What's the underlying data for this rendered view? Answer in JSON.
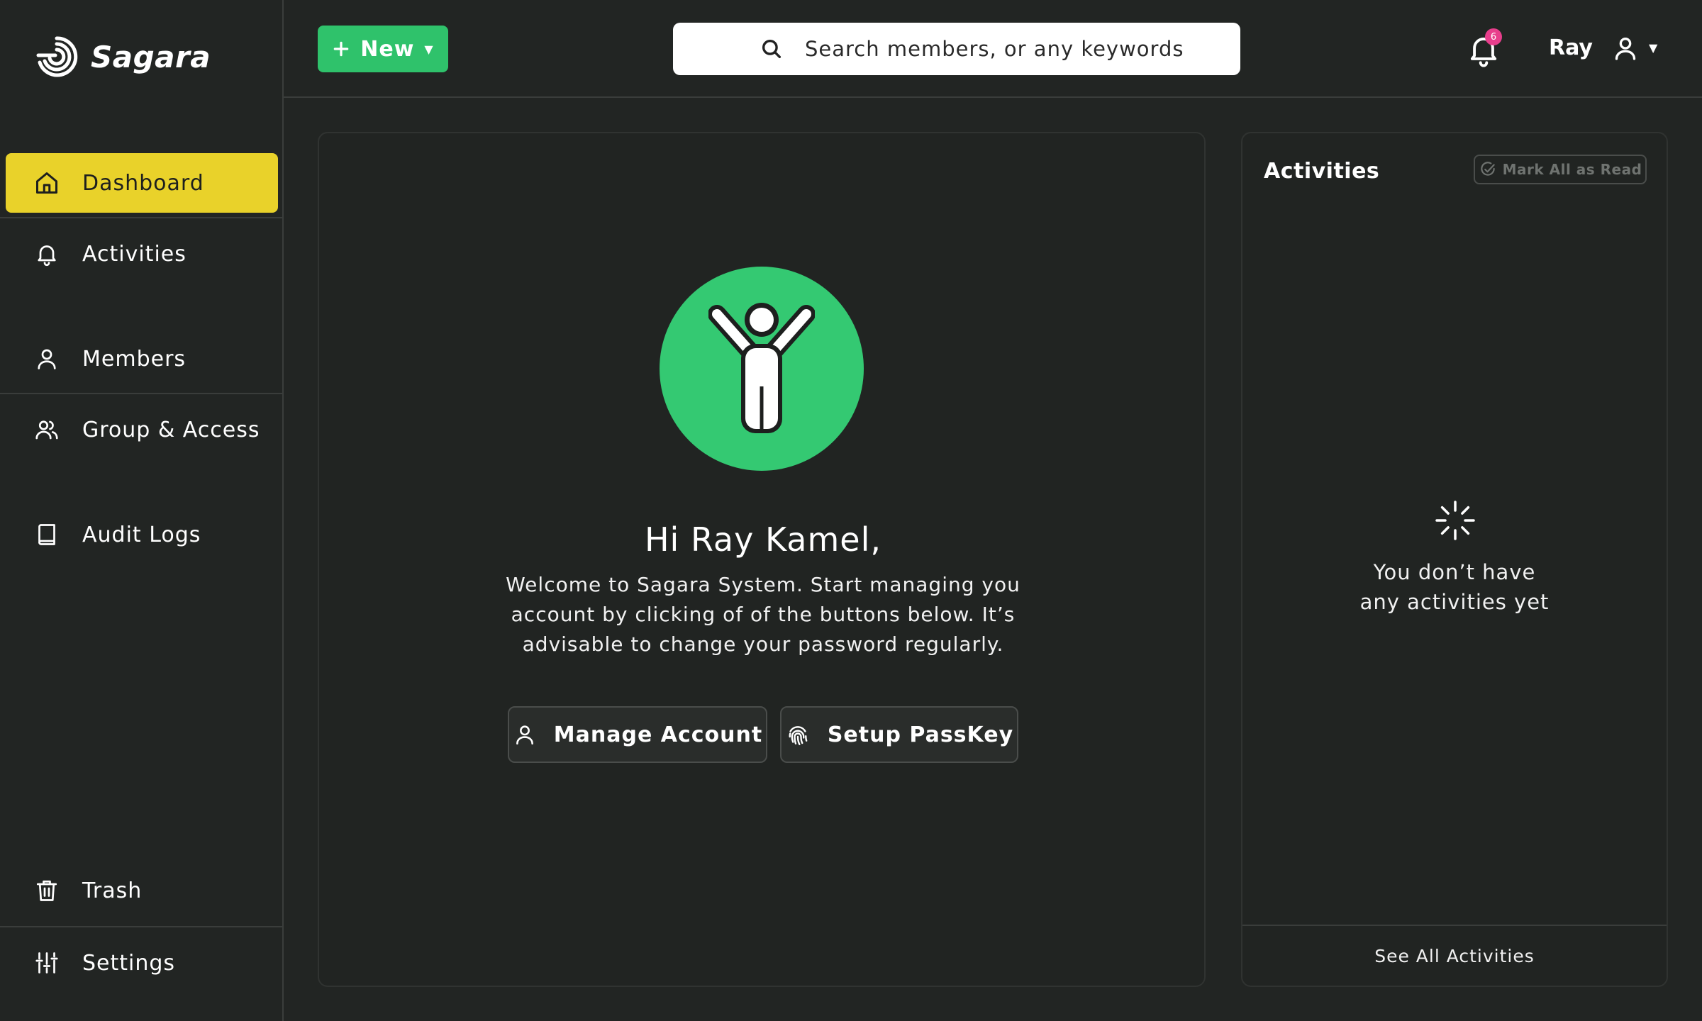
{
  "brand": {
    "name": "Sagara",
    "icon": "sagara-logo-spiral"
  },
  "colors": {
    "accent": "#e9d22a",
    "primary": "#2fc26b",
    "background": "#222523",
    "badge": "#e83e8c"
  },
  "sidebar": {
    "items": [
      {
        "label": "Dashboard",
        "icon": "home-icon",
        "active": true
      },
      {
        "label": "Activities",
        "icon": "bell-icon"
      },
      {
        "label": "Members",
        "icon": "user-icon"
      },
      {
        "label": "Group & Access",
        "icon": "users-icon"
      },
      {
        "label": "Audit Logs",
        "icon": "book-icon"
      },
      {
        "label": "Trash",
        "icon": "trash-icon"
      },
      {
        "label": "Settings",
        "icon": "sliders-icon"
      }
    ]
  },
  "header": {
    "new_label": "New",
    "search_placeholder": "Search members, or any keywords",
    "notification_count": "6",
    "user_name": "Ray"
  },
  "main": {
    "greeting": "Hi Ray Kamel,",
    "welcome": "Welcome to Sagara System. Start managing you account by clicking of of the buttons below. It’s advisable to change your password regularly.",
    "manage_label": "Manage Account",
    "passkey_label": "Setup PassKey"
  },
  "activities": {
    "title": "Activities",
    "mark_read_label": "Mark All as Read",
    "empty_line1": "You don’t have",
    "empty_line2": "any activities yet",
    "see_all_label": "See All Activities"
  }
}
